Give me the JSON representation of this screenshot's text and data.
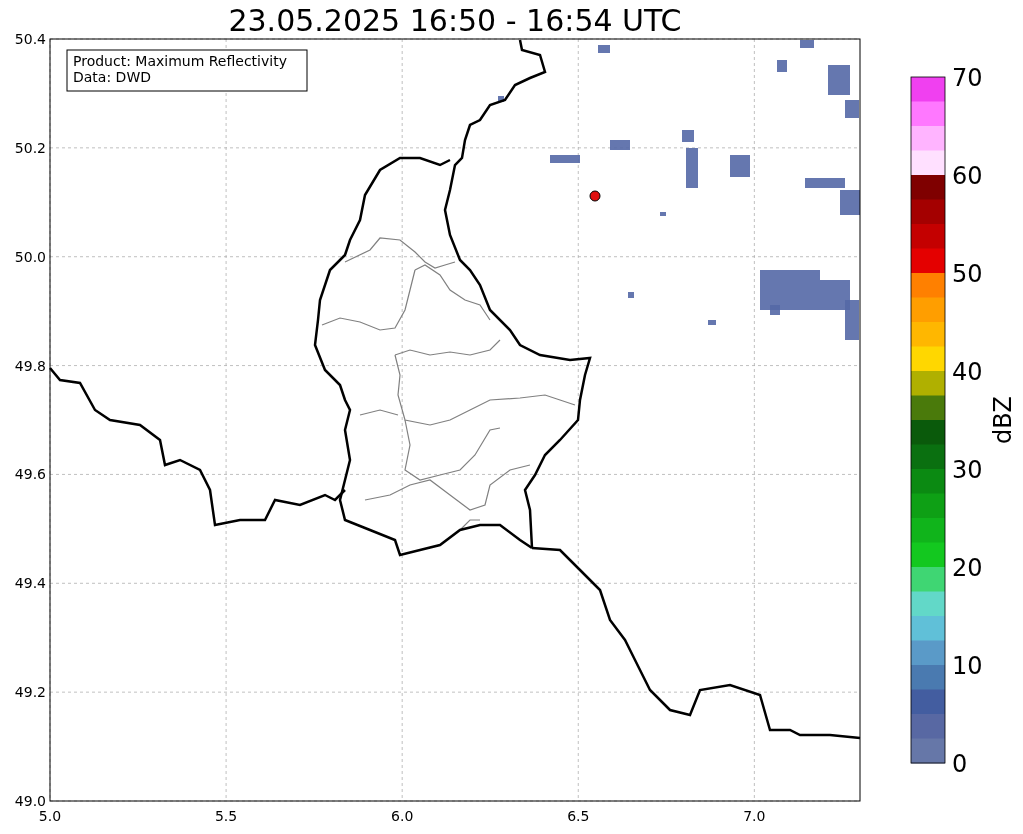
{
  "title": "23.05.2025 16:50 - 16:54 UTC",
  "info_box": [
    "Product: Maximum Reflectivity",
    "Data: DWD"
  ],
  "x_ticks": [
    "5.0",
    "5.5",
    "6.0",
    "6.5",
    "7.0"
  ],
  "y_ticks": [
    "50.4",
    "50.2",
    "50.0",
    "49.8",
    "49.6",
    "49.4",
    "49.2",
    "49.0"
  ],
  "colorbar": {
    "label": "dBZ",
    "ticks": [
      "70",
      "60",
      "50",
      "40",
      "30",
      "20",
      "10",
      "0"
    ],
    "bands": [
      {
        "color": "#f040f0"
      },
      {
        "color": "#ff78ff"
      },
      {
        "color": "#ffb4ff"
      },
      {
        "color": "#ffe0ff"
      },
      {
        "color": "#7f0000"
      },
      {
        "color": "#a40000"
      },
      {
        "color": "#c40000"
      },
      {
        "color": "#e40000"
      },
      {
        "color": "#ff8000"
      },
      {
        "color": "#ff9e00"
      },
      {
        "color": "#ffb700"
      },
      {
        "color": "#ffd700"
      },
      {
        "color": "#b0b000"
      },
      {
        "color": "#4a7a0b"
      },
      {
        "color": "#0a5a0b"
      },
      {
        "color": "#0a7010"
      },
      {
        "color": "#0b8a12"
      },
      {
        "color": "#0ea015"
      },
      {
        "color": "#10b41b"
      },
      {
        "color": "#13c81f"
      },
      {
        "color": "#3fd673"
      },
      {
        "color": "#62d8c8"
      },
      {
        "color": "#60c0d8"
      },
      {
        "color": "#5a9ac8"
      },
      {
        "color": "#4a7ab0"
      },
      {
        "color": "#435da0"
      },
      {
        "color": "#5868a3"
      },
      {
        "color": "#6677a8"
      }
    ]
  }
}
